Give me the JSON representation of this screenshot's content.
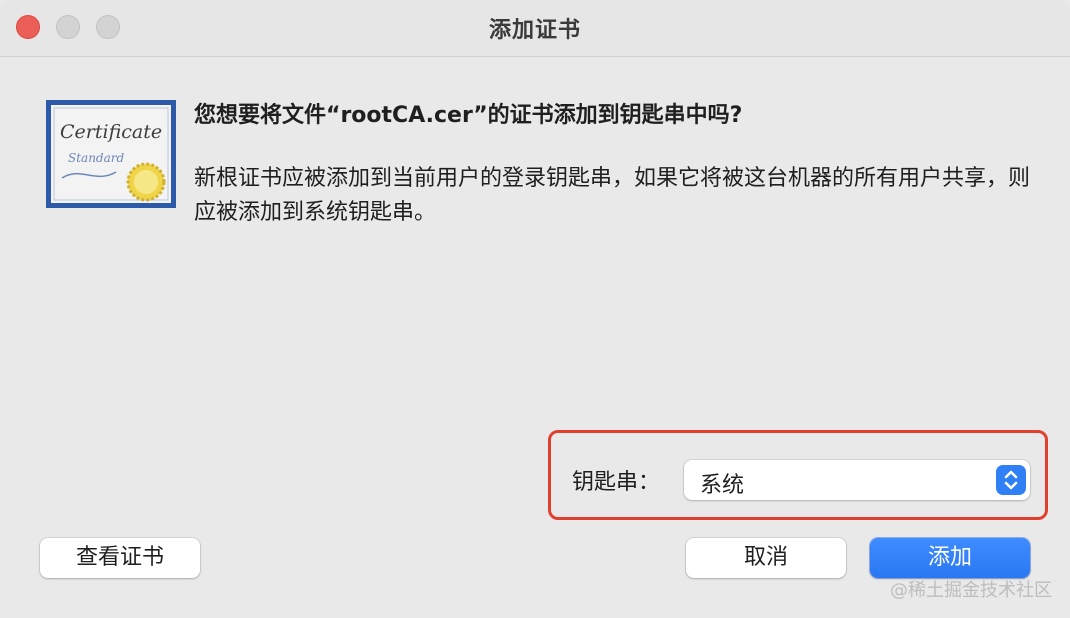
{
  "window": {
    "title": "添加证书"
  },
  "dialog": {
    "heading": "您想要将文件“rootCA.cer”的证书添加到钥匙串中吗?",
    "message": "新根证书应被添加到当前用户的登录钥匙串，如果它将被这台机器的所有用户共享，则应被添加到系统钥匙串。",
    "icon": "certificate-icon",
    "icon_text_1": "Certificate",
    "icon_text_2": "Standard"
  },
  "keychain": {
    "label": "钥匙串：",
    "selected": "系统"
  },
  "buttons": {
    "view_certificate": "查看证书",
    "cancel": "取消",
    "add": "添加"
  },
  "colors": {
    "accent": "#2f7ff5",
    "highlight": "#e2402f",
    "close": "#ec5f58"
  },
  "watermark": "@稀土掘金技术社区"
}
